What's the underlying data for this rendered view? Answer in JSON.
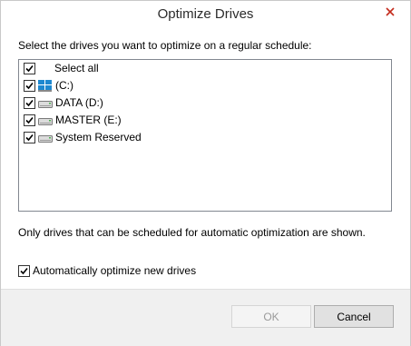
{
  "window": {
    "title": "Optimize Drives"
  },
  "instruction": "Select the drives you want to optimize on a regular schedule:",
  "drives": [
    {
      "label": "Select all",
      "checked": true,
      "icon": "none"
    },
    {
      "label": "(C:)",
      "checked": true,
      "icon": "windows-drive-icon"
    },
    {
      "label": "DATA (D:)",
      "checked": true,
      "icon": "drive-icon"
    },
    {
      "label": "MASTER (E:)",
      "checked": true,
      "icon": "drive-icon"
    },
    {
      "label": "System Reserved",
      "checked": true,
      "icon": "drive-icon"
    }
  ],
  "note": "Only drives that can be scheduled for automatic optimization are shown.",
  "auto_optimize": {
    "label": "Automatically optimize new drives",
    "checked": true
  },
  "buttons": {
    "ok": "OK",
    "cancel": "Cancel"
  },
  "colors": {
    "title_bar": "#ffffff",
    "close_icon": "#c42b1c",
    "windows_logo": "#1e88d0",
    "disabled_text": "#9a9a9a"
  }
}
